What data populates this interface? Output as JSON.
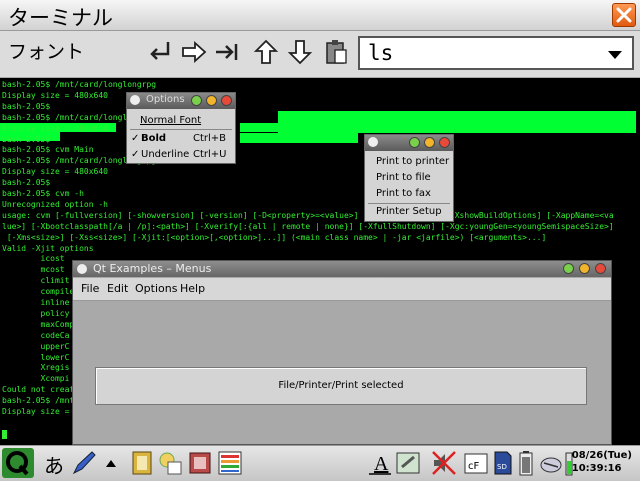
{
  "window": {
    "title": "ターミナル"
  },
  "toolbar": {
    "font_label": "フォント",
    "command_value": "ls"
  },
  "terminal": {
    "lines": [
      "bash-2.05$ /mnt/card/longlongrpg",
      "Display size = 480x640",
      "bash-2.05$",
      "bash-2.05$ /mnt/card/longlongrpg",
      "Display size = 480x640",
      "bash-2.05$",
      "bash-2.05$ cvm Main",
      "bash-2.05$ /mnt/card/longlongrpg",
      "Display size = 480x640",
      "bash-2.05$",
      "bash-2.05$ cvm -h",
      "Unrecognized option -h",
      "usage: cvm [-fullversion] [-showversion] [-version] [-D<property>=<value>] [-XbuildOptions] [-XshowBuildOptions] [-XappName=<va",
      "lue>] [-Xbootclasspath[/a | /p]:<path>] [-Xverify[:{all | remote | none}] [-XfullShutdown] [-Xgc:youngGen=<youngSemispaceSize>]",
      " [-Xms<size>] [-Xss<size>] [-Xjit:[<option>[,<option>]...]] (<main class name> | -jar <jarfile>) [<arguments>...]",
      "Valid -Xjit options",
      "        icost",
      "        mcost",
      "        climit",
      "        compile",
      "        inline",
      "        policy",
      "        maxComp",
      "        codeCa",
      "        upperC",
      "        lowerC",
      "        Xregis",
      "        Xcompi",
      "Could not create",
      "bash-2.05$ /mnt",
      "Display size ="
    ]
  },
  "options_popup": {
    "title": "Options",
    "items": [
      {
        "label": "Normal Font",
        "shortcut": ""
      },
      {
        "label": "Bold",
        "shortcut": "Ctrl+B"
      },
      {
        "label": "Underline",
        "shortcut": "Ctrl+U"
      }
    ]
  },
  "print_popup": {
    "items": [
      "Print to printer",
      "Print to file",
      "Print to fax",
      "Printer Setup"
    ]
  },
  "qt_window": {
    "title": "Qt Examples – Menus",
    "menus": [
      "File",
      "Edit",
      "Options",
      "Help"
    ],
    "status": "File/Printer/Print selected"
  },
  "taskbar": {
    "input_char": "あ",
    "date": "08/26(Tue)",
    "time": "10:39:16"
  },
  "colors": {
    "terminal_text": "#33ee33",
    "highlight": "#00ff33",
    "close_button": "#e05a10"
  }
}
